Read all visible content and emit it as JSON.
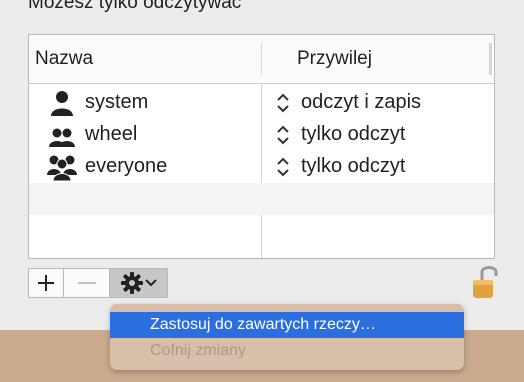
{
  "header": {
    "text": "Możesz tylko odczytywać"
  },
  "table": {
    "columns": [
      "Nazwa",
      "Przywilej"
    ],
    "rows": [
      {
        "name": "system",
        "privilege": "odczyt i zapis",
        "icon": "single-user-icon"
      },
      {
        "name": "wheel",
        "privilege": "tylko odczyt",
        "icon": "group-icon"
      },
      {
        "name": "everyone",
        "privilege": "tylko odczyt",
        "icon": "everyone-icon"
      }
    ]
  },
  "toolbar": {
    "add_label": "+",
    "remove_label": "−",
    "gear_icon": "gear-icon",
    "chevron_icon": "chevron-down-icon"
  },
  "lock": {
    "icon": "unlocked-padlock-icon"
  },
  "menu": {
    "items": [
      {
        "label": "Zastosuj do zawartych rzeczy…",
        "state": "highlighted"
      },
      {
        "label": "Cofnij zmiany",
        "state": "disabled"
      }
    ]
  },
  "colors": {
    "highlight": "#2a6ee0",
    "panel": "#ececec",
    "desktop": "#c9aa8d"
  }
}
